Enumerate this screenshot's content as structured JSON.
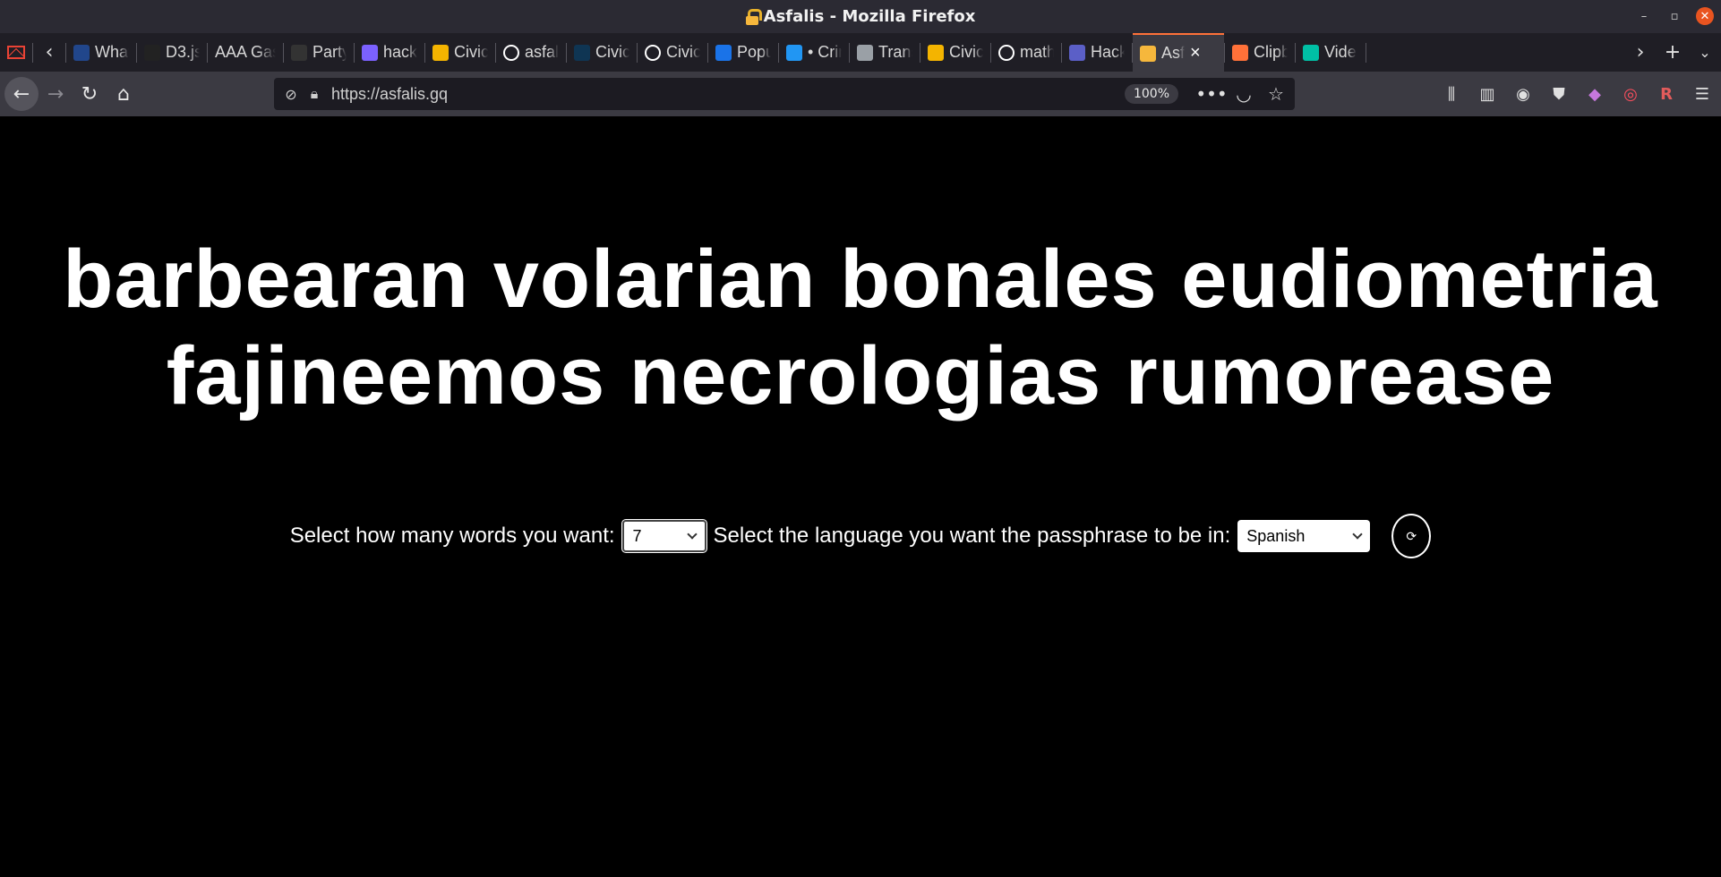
{
  "window": {
    "title": "Asfalis - Mozilla Firefox"
  },
  "tabs": [
    {
      "label": "",
      "icon": "gmail-icon",
      "color": "#ea4335"
    },
    {
      "label": "What",
      "icon": "flag-icon",
      "color": "#21468b"
    },
    {
      "label": "D3.js",
      "icon": "d3-icon",
      "color": "#222222"
    },
    {
      "label": "AAA Gas",
      "icon": "",
      "color": ""
    },
    {
      "label": "Party",
      "icon": "spinner-icon",
      "color": "#333333"
    },
    {
      "label": "hack",
      "icon": "record-icon",
      "color": "#7b61ff"
    },
    {
      "label": "Civic",
      "icon": "slides-icon",
      "color": "#f4b400"
    },
    {
      "label": "asfal",
      "icon": "github-icon",
      "color": "#ffffff"
    },
    {
      "label": "Civic",
      "icon": "d-icon",
      "color": "#0f3553"
    },
    {
      "label": "Civic",
      "icon": "github-icon",
      "color": "#ffffff"
    },
    {
      "label": "Popu",
      "icon": "k-icon",
      "color": "#1a73e8"
    },
    {
      "label": "• Crin",
      "icon": "chart-icon",
      "color": "#2196f3"
    },
    {
      "label": "Trans",
      "icon": "book-icon",
      "color": "#9aa0a6"
    },
    {
      "label": "Civic",
      "icon": "slides-icon",
      "color": "#f4b400"
    },
    {
      "label": "math",
      "icon": "github-icon",
      "color": "#ffffff"
    },
    {
      "label": "Hack",
      "icon": "docs-icon",
      "color": "#5b5fc7"
    },
    {
      "label": "Asf",
      "icon": "lock-icon",
      "color": "#f6b73c",
      "active": true
    },
    {
      "label": "Clipb",
      "icon": "w3-icon",
      "color": "#ff7139"
    },
    {
      "label": "Vide",
      "icon": "puzzle-icon",
      "color": "#00bfa5"
    }
  ],
  "navbar": {
    "url": "https://asfalis.gq",
    "zoom": "100%"
  },
  "page": {
    "passphrase_line1": "barbearan volarian bonales eudiometria",
    "passphrase_line2": "fajineemos necrologias rumorease",
    "words_label": "Select how many words you want:",
    "words_value": "7",
    "language_label": "Select the language you want the passphrase to be in:",
    "language_value": "Spanish",
    "refresh_icon": "refresh-icon"
  },
  "colors": {
    "background": "#000000",
    "text": "#ffffff",
    "accent_tab": "#ff7139"
  }
}
